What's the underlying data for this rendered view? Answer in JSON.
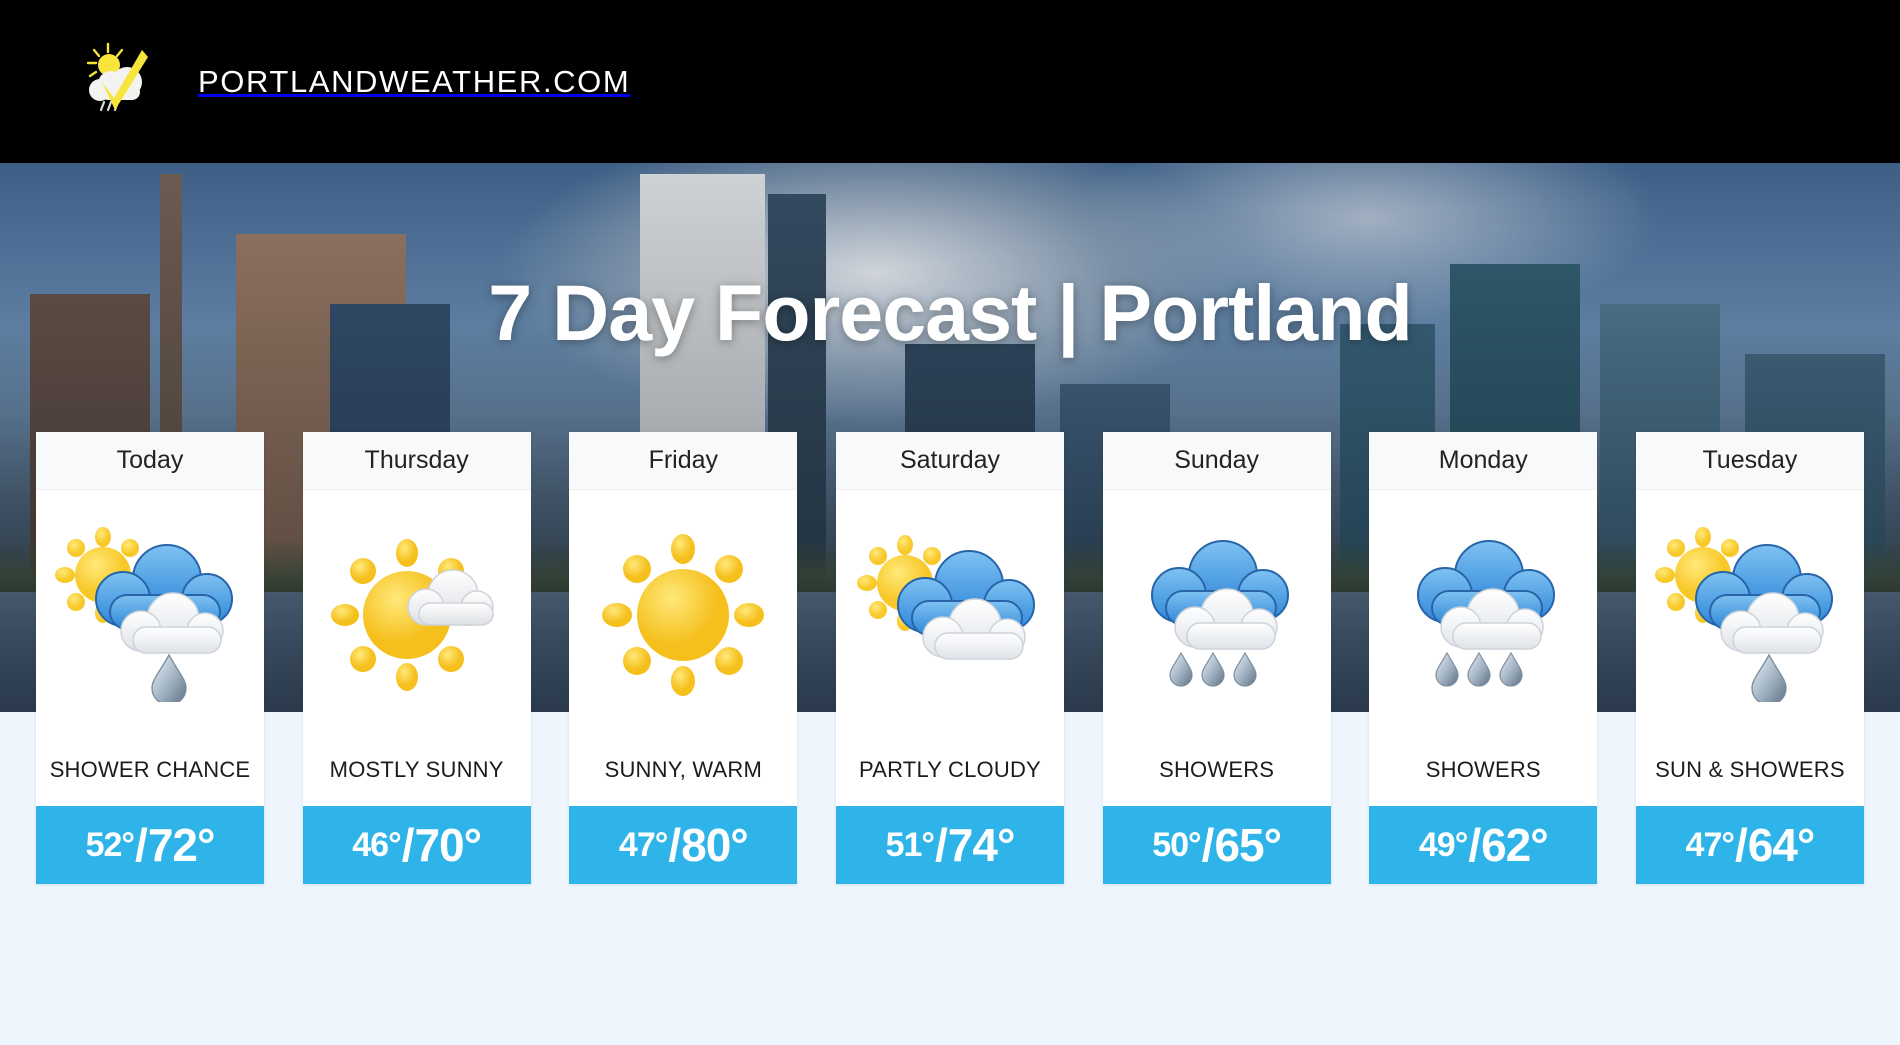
{
  "site": {
    "logo_icon": "sun-cloud-rain-check-logo-icon",
    "brand": "PORTLANDWEATHER.COM",
    "topbar_bg": "#000000"
  },
  "hero": {
    "title": "7 Day Forecast | Portland",
    "title_color": "#ffffff"
  },
  "theme": {
    "temp_band": "#2fb4e9",
    "page_bg": "#eef5fd",
    "card_bg": "#ffffff",
    "card_head_bg": "#f8f9fa"
  },
  "forecast": {
    "days": [
      {
        "day": "Today",
        "icon": "sun-cloud-rain-icon",
        "condition": "SHOWER CHANCE",
        "low": "52°",
        "sep": "/",
        "high": "72°",
        "temp_range": "52°/72°"
      },
      {
        "day": "Thursday",
        "icon": "sun-small-cloud-icon",
        "condition": "MOSTLY SUNNY",
        "low": "46°",
        "sep": "/",
        "high": "70°",
        "temp_range": "46°/70°"
      },
      {
        "day": "Friday",
        "icon": "sun-icon",
        "condition": "SUNNY, WARM",
        "low": "47°",
        "sep": "/",
        "high": "80°",
        "temp_range": "47°/80°"
      },
      {
        "day": "Saturday",
        "icon": "sun-clouds-icon",
        "condition": "PARTLY CLOUDY",
        "low": "51°",
        "sep": "/",
        "high": "74°",
        "temp_range": "51°/74°"
      },
      {
        "day": "Sunday",
        "icon": "clouds-rain-icon",
        "condition": "SHOWERS",
        "low": "50°",
        "sep": "/",
        "high": "65°",
        "temp_range": "50°/65°"
      },
      {
        "day": "Monday",
        "icon": "clouds-rain-icon",
        "condition": "SHOWERS",
        "low": "49°",
        "sep": "/",
        "high": "62°",
        "temp_range": "49°/62°"
      },
      {
        "day": "Tuesday",
        "icon": "sun-cloud-rain-icon",
        "condition": "SUN & SHOWERS",
        "low": "47°",
        "sep": "/",
        "high": "64°",
        "temp_range": "47°/64°"
      }
    ]
  }
}
